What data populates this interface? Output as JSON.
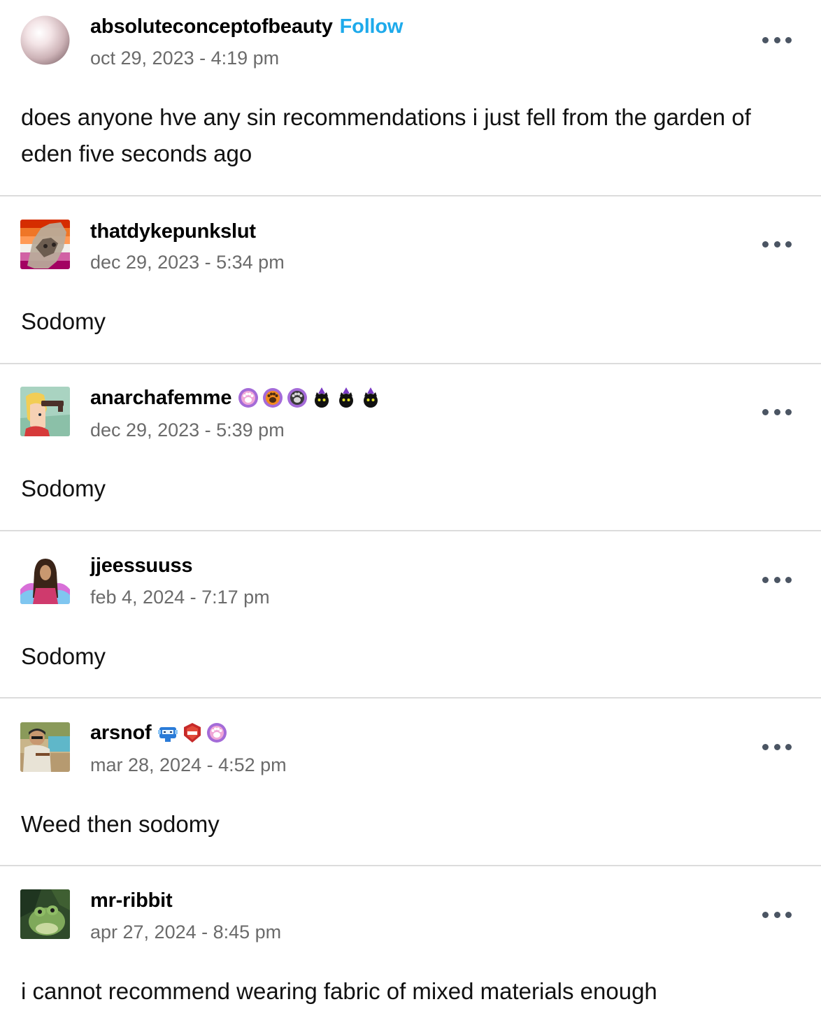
{
  "replies": [
    {
      "username": "absoluteconceptofbeauty",
      "follow_label": "Follow",
      "timestamp": "oct 29, 2023 - 4:19 pm",
      "text": "does anyone hve any sin recommendations i just fell from the garden of eden five seconds ago",
      "avatar": "pearl-avatar"
    },
    {
      "username": "thatdykepunkslut",
      "timestamp": "dec 29, 2023 - 5:34 pm",
      "text": "Sodomy",
      "avatar": "wolf-pride-flag-avatar"
    },
    {
      "username": "anarchafemme",
      "timestamp": "dec 29, 2023 - 5:39 pm",
      "text": "Sodomy",
      "avatar": "cartoon-portrait-avatar",
      "badges": [
        "pink-paw-badge",
        "orange-paw-badge",
        "gray-paw-badge",
        "witch-cat-badge",
        "witch-cat-badge",
        "witch-cat-badge"
      ]
    },
    {
      "username": "jjeessuuss",
      "timestamp": "feb 4, 2024 - 7:17 pm",
      "text": "Sodomy",
      "avatar": "jesus-trans-flag-avatar"
    },
    {
      "username": "arsnof",
      "timestamp": "mar 28, 2024 - 4:52 pm",
      "text": "Weed then sodomy",
      "avatar": "man-by-pool-avatar",
      "badges": [
        "blue-robot-badge",
        "red-shield-badge",
        "pink-paw-badge"
      ]
    },
    {
      "username": "mr-ribbit",
      "timestamp": "apr 27, 2024 - 8:45 pm",
      "text": "i cannot recommend wearing fabric of mixed materials enough",
      "avatar": "frog-avatar"
    }
  ],
  "colors": {
    "follow": "#1eaaeb",
    "timestamp": "#6b6b6b",
    "divider": "#dcdcdc",
    "more_dots": "#4b5563"
  }
}
